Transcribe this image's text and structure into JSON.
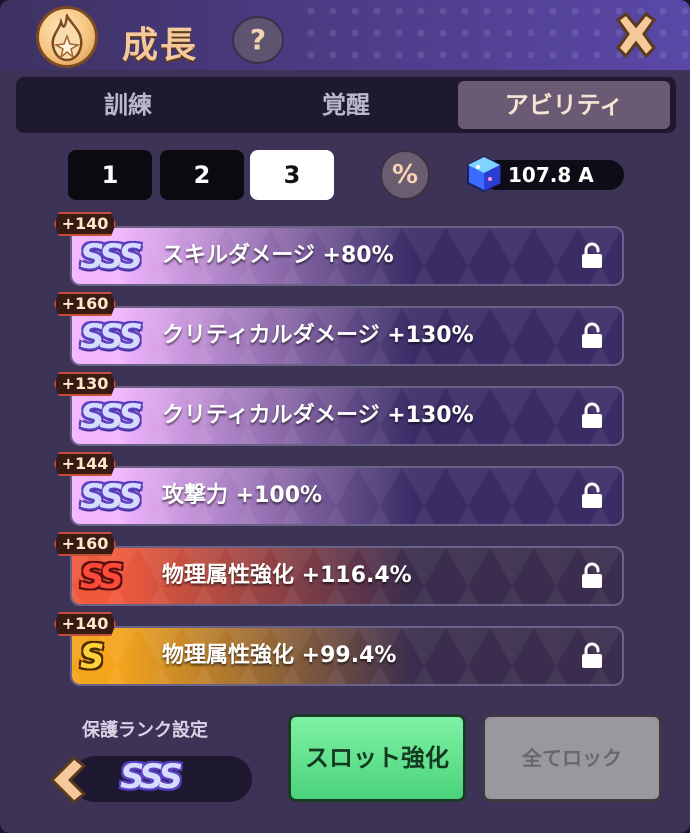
{
  "header": {
    "title": "成長",
    "help": "?",
    "title_icon": "flame-icon",
    "close_icon": "close-icon"
  },
  "tabs": [
    {
      "label": "訓練",
      "active": false
    },
    {
      "label": "覚醒",
      "active": false
    },
    {
      "label": "アビリティ",
      "active": true
    }
  ],
  "pages": [
    {
      "label": "1",
      "active": false
    },
    {
      "label": "2",
      "active": false
    },
    {
      "label": "3",
      "active": true
    }
  ],
  "percent_label": "%",
  "currency": {
    "icon": "cube-icon",
    "value": "107.8 A"
  },
  "abilities": [
    {
      "badge": "+140",
      "rank": "SSS",
      "text": "スキルダメージ +80%",
      "locked": false,
      "colors": [
        "#f2b6ff",
        "#3a2d66"
      ]
    },
    {
      "badge": "+160",
      "rank": "SSS",
      "text": "クリティカルダメージ +130%",
      "locked": false,
      "colors": [
        "#f2b6ff",
        "#3a2d66"
      ]
    },
    {
      "badge": "+130",
      "rank": "SSS",
      "text": "クリティカルダメージ +130%",
      "locked": false,
      "colors": [
        "#f2b6ff",
        "#3a2d66"
      ]
    },
    {
      "badge": "+144",
      "rank": "SSS",
      "text": "攻撃力 +100%",
      "locked": false,
      "colors": [
        "#f2b6ff",
        "#3a2d66"
      ]
    },
    {
      "badge": "+160",
      "rank": "SS",
      "text": "物理属性強化 +116.4%",
      "locked": false,
      "colors": [
        "#f05a3c",
        "#3a2d4e"
      ]
    },
    {
      "badge": "+140",
      "rank": "S",
      "text": "物理属性強化 +99.4%",
      "locked": false,
      "colors": [
        "#f5a51c",
        "#3a2d4e"
      ]
    }
  ],
  "protect": {
    "label": "保護ランク設定",
    "rank": "SSS"
  },
  "buttons": {
    "slot_upgrade": "スロット強化",
    "lock_all": "全てロック"
  }
}
